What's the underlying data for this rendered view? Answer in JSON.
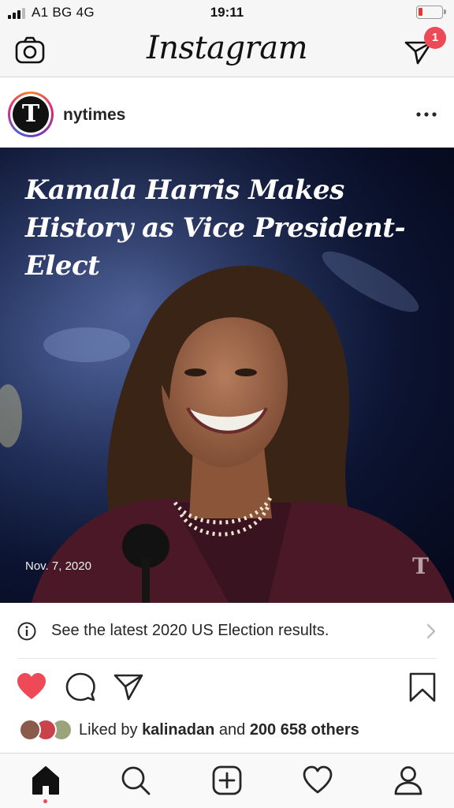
{
  "status_bar": {
    "carrier": "A1 BG  4G",
    "time": "19:11"
  },
  "top_nav": {
    "logo": "Instagram",
    "dm_badge": "1"
  },
  "post": {
    "avatar_glyph": "T",
    "username": "nytimes",
    "headline_line1": "Kamala Harris Makes",
    "headline_line2": "History as Vice President-Elect",
    "date": "Nov. 7, 2020",
    "watermark": "T",
    "election_link": "See the latest 2020 US Election results.",
    "liked_by_prefix": "Liked by ",
    "liked_by_user": "kalinadan",
    "liked_by_and": " and ",
    "liked_by_count": "200 658 others"
  },
  "colors": {
    "like_red": "#ed4956",
    "badge_red": "#ed4956"
  },
  "icons": [
    "camera-icon",
    "direct-message-icon",
    "more-icon",
    "info-icon",
    "chevron-right-icon",
    "heart-icon",
    "comment-icon",
    "share-icon",
    "bookmark-icon",
    "home-icon",
    "search-icon",
    "add-post-icon",
    "activity-icon",
    "profile-icon"
  ]
}
